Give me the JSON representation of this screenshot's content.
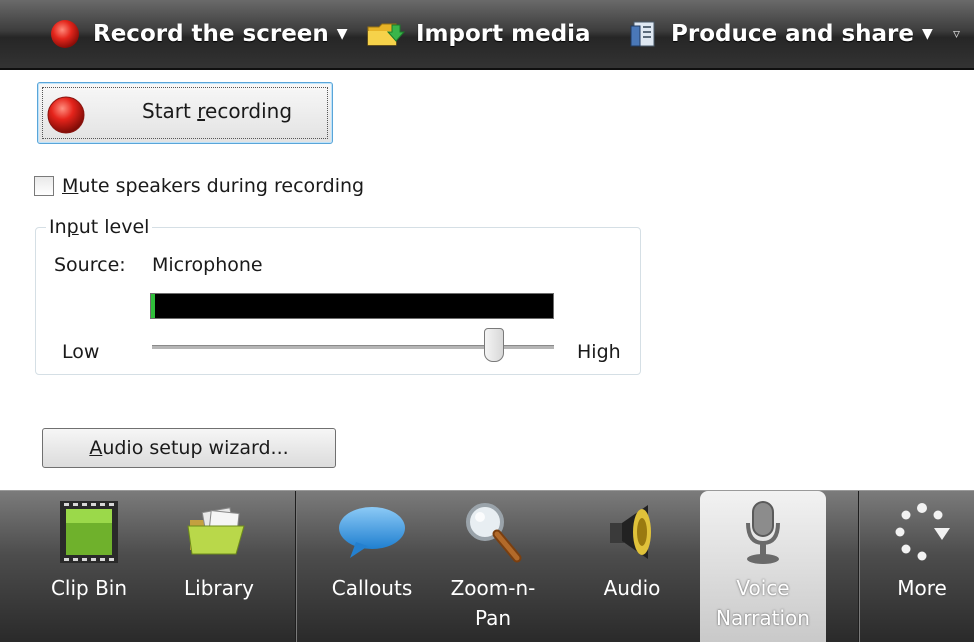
{
  "toolbar": {
    "record": {
      "label": "Record the screen",
      "icon": "record-icon"
    },
    "import": {
      "label": "Import media",
      "icon": "folder-import-icon"
    },
    "produce": {
      "label": "Produce and share",
      "icon": "produce-icon"
    },
    "dropdown_caret": "▼",
    "overflow_glyph": "▿"
  },
  "recording": {
    "start_prefix": "Start ",
    "start_accel": "r",
    "start_suffix": "ecording",
    "mute_accel": "M",
    "mute_rest": "ute speakers during recording",
    "mute_checked": false
  },
  "input_level": {
    "legend_pre": "In",
    "legend_accel": "p",
    "legend_post": "ut level",
    "source_label": "Source:",
    "source_value": "Microphone",
    "meter_level": 0.01,
    "slider_low": "Low",
    "slider_high": "High",
    "slider_value": 0.85
  },
  "wizard": {
    "accel": "A",
    "rest": "udio setup wizard..."
  },
  "tabs": [
    {
      "label": "Clip Bin",
      "icon": "film-strip-icon",
      "active": false
    },
    {
      "label": "Library",
      "icon": "folder-icon",
      "active": false
    },
    {
      "label": "Callouts",
      "icon": "speech-bubble-icon",
      "active": false
    },
    {
      "label": "Zoom-n-\nPan",
      "icon": "magnifier-icon",
      "active": false
    },
    {
      "label": "Audio",
      "icon": "speaker-icon",
      "active": false
    },
    {
      "label": "Voice\nNarration",
      "icon": "microphone-icon",
      "active": true
    },
    {
      "label": "More",
      "icon": "more-icon",
      "active": false
    }
  ],
  "colors": {
    "record_red": "#d8231c",
    "meter_green": "#2fbf3a",
    "folder_yellow": "#f2c230",
    "callout_blue": "#2f8fd8"
  }
}
